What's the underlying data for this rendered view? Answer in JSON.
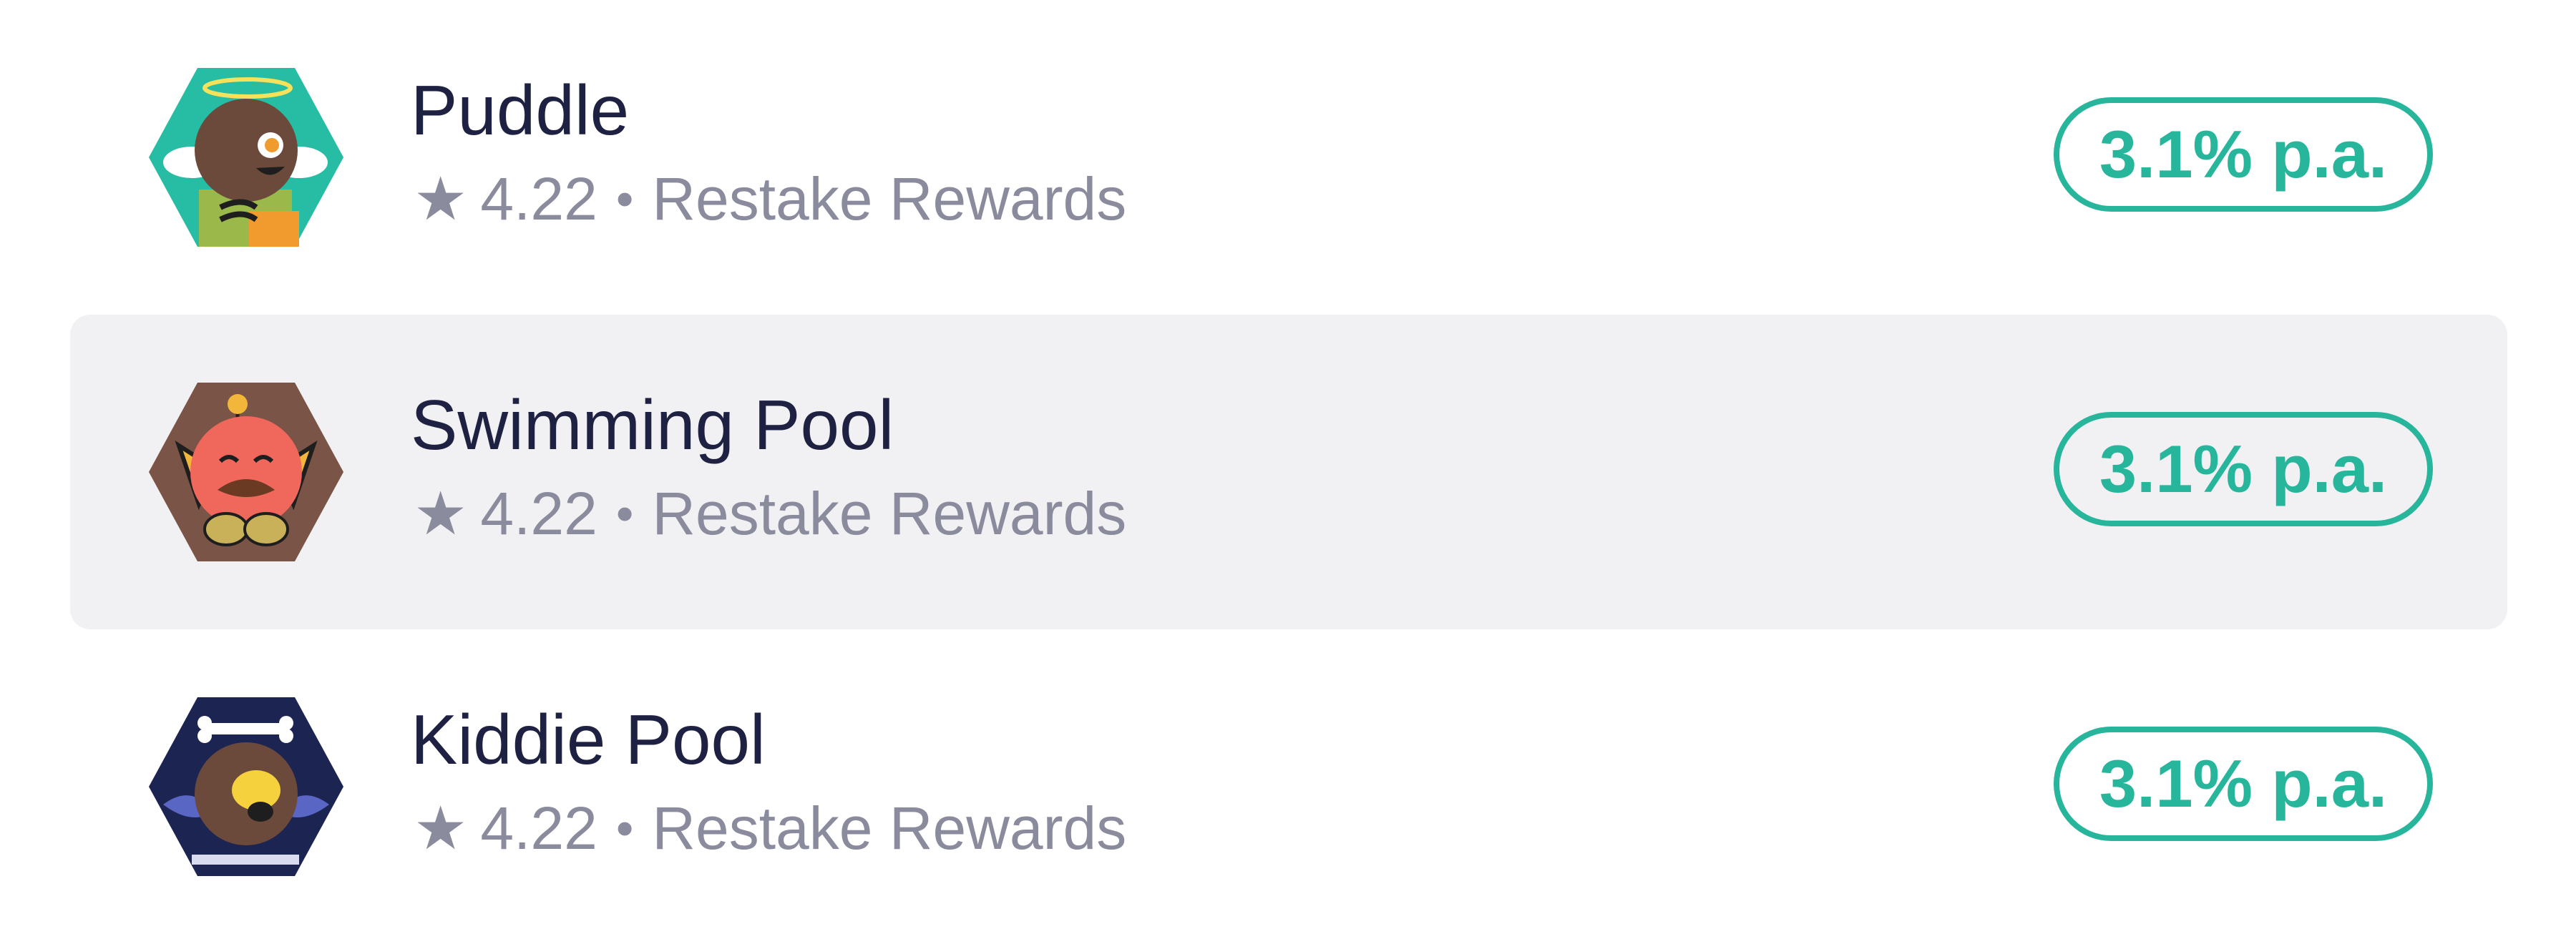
{
  "pools": [
    {
      "name": "Puddle",
      "rating": "4.22",
      "separator": "•",
      "reward_type": "Restake Rewards",
      "apy": "3.1% p.a.",
      "selected": false,
      "avatar_color": "#27bca4",
      "icon": "angel-bird-icon"
    },
    {
      "name": "Swimming Pool",
      "rating": "4.22",
      "separator": "•",
      "reward_type": "Restake Rewards",
      "apy": "3.1% p.a.",
      "selected": true,
      "avatar_color": "#7a5446",
      "icon": "red-cat-icon"
    },
    {
      "name": "Kiddie Pool",
      "rating": "4.22",
      "separator": "•",
      "reward_type": "Restake Rewards",
      "apy": "3.1% p.a.",
      "selected": false,
      "avatar_color": "#1c2552",
      "icon": "pirate-bird-icon"
    }
  ],
  "colors": {
    "accent": "#27b59c",
    "title_text": "#1e2142",
    "meta_text": "#8a8b9c",
    "selected_bg": "#f1f1f3"
  }
}
